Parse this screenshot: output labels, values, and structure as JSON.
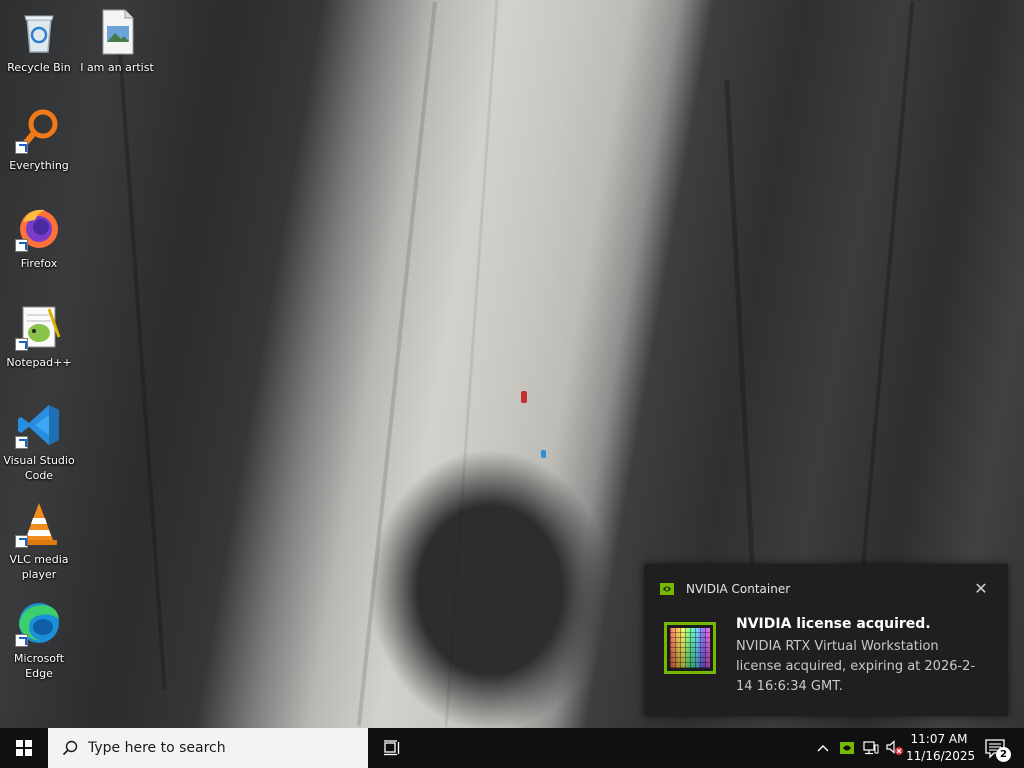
{
  "desktop": {
    "icons": [
      {
        "label": "Recycle Bin",
        "icon": "recycle-bin-icon"
      },
      {
        "label": "I am an artist",
        "icon": "image-file-icon"
      },
      {
        "label": "Everything",
        "icon": "everything-search-icon"
      },
      {
        "label": "Firefox",
        "icon": "firefox-icon"
      },
      {
        "label": "Notepad++",
        "icon": "notepad-plus-plus-icon"
      },
      {
        "label": "Visual Studio Code",
        "icon": "vscode-icon"
      },
      {
        "label": "VLC media player",
        "icon": "vlc-icon"
      },
      {
        "label": "Microsoft Edge",
        "icon": "edge-icon"
      }
    ]
  },
  "toast": {
    "app_name": "NVIDIA Container",
    "title": "NVIDIA license acquired.",
    "body": "NVIDIA RTX Virtual Workstation license acquired, expiring at 2026-2-14 16:6:34 GMT.",
    "accent_color": "#76b900"
  },
  "taskbar": {
    "search_placeholder": "Type here to search",
    "time": "11:07 AM",
    "date": "11/16/2025",
    "notification_count": "2"
  },
  "colors": {
    "taskbar_bg": "#101010",
    "toast_bg": "#1f1f1f",
    "vscode_blue": "#2a8ee0",
    "nvidia_green": "#76b900"
  }
}
